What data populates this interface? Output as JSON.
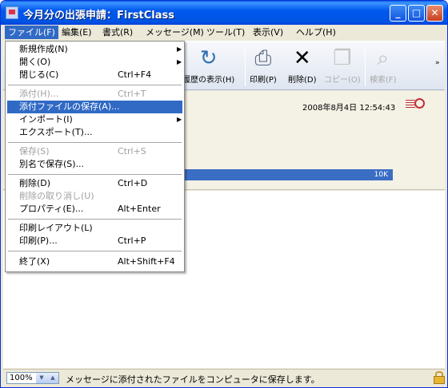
{
  "window": {
    "title": "今月分の出張申請：FirstClass",
    "min_glyph": "_",
    "max_glyph": "□",
    "close_glyph": "✕"
  },
  "menubar": [
    {
      "label": "ファイル(F)",
      "active": true
    },
    {
      "label": "編集(E)"
    },
    {
      "label": "書式(R)"
    },
    {
      "label": "メッセージ(M)"
    },
    {
      "label": "ツール(T)"
    },
    {
      "label": "表示(V)"
    },
    {
      "label": "ヘルプ(H)"
    }
  ],
  "toolbar": {
    "history": {
      "label": "履歴の表示(H)",
      "icon": "history-icon"
    },
    "print": {
      "label": "印刷(P)",
      "icon": "printer-icon"
    },
    "delete": {
      "label": "削除(D)",
      "icon": "delete-x-icon"
    },
    "copy": {
      "label": "コピー(O)",
      "icon": "copy-icon",
      "disabled": true
    },
    "search": {
      "label": "検索(F)",
      "icon": "search-icon",
      "disabled": true
    },
    "overflow": "»"
  },
  "message": {
    "date": "2008年8月4日 12:54:43",
    "attachment_size": "10K"
  },
  "file_menu": {
    "items": [
      {
        "label": "新規作成(N)",
        "submenu": true
      },
      {
        "label": "開く(O)",
        "submenu": true
      },
      {
        "label": "閉じる(C)",
        "shortcut": "Ctrl+F4"
      },
      {
        "label": "添付(H)...",
        "shortcut": "Ctrl+T",
        "disabled": true
      },
      {
        "label": "添付ファイルの保存(A)...",
        "highlighted": true
      },
      {
        "label": "インポート(I)",
        "submenu": true
      },
      {
        "label": "エクスポート(T)..."
      },
      {
        "label": "保存(S)",
        "shortcut": "Ctrl+S",
        "disabled": true
      },
      {
        "label": "別名で保存(S)..."
      },
      {
        "label": "削除(D)",
        "shortcut": "Ctrl+D"
      },
      {
        "label": "削除の取り消し(U)",
        "disabled": true
      },
      {
        "label": "プロパティ(E)...",
        "shortcut": "Alt+Enter"
      },
      {
        "label": "印刷レイアウト(L)"
      },
      {
        "label": "印刷(P)...",
        "shortcut": "Ctrl+P"
      },
      {
        "label": "終了(X)",
        "shortcut": "Alt+Shift+F4"
      }
    ]
  },
  "statusbar": {
    "zoom": "100%",
    "text": "メッセージに添付されたファイルをコンピュータに保存します。"
  },
  "colors": {
    "titlebar": "#0054e3",
    "highlight": "#316ac5",
    "menu_bg": "#ece9d8"
  }
}
